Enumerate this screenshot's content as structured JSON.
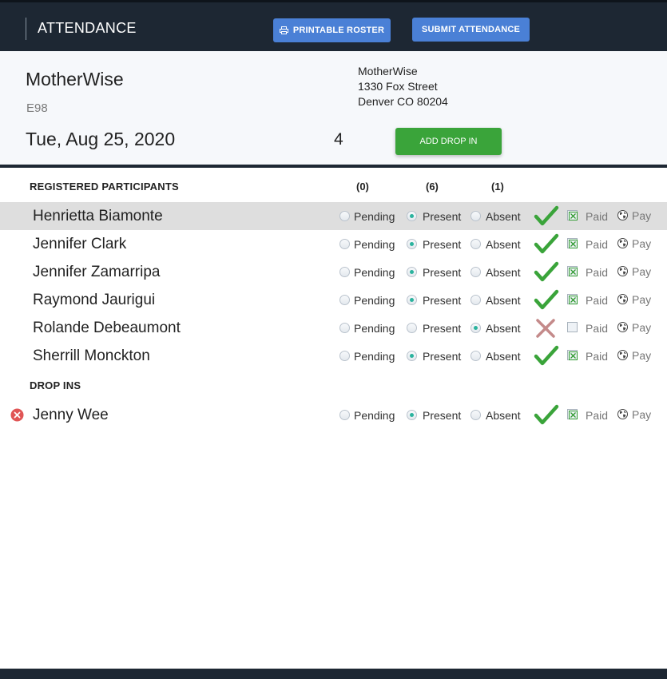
{
  "header": {
    "title": "ATTENDANCE",
    "print_label": "PRINTABLE ROSTER",
    "submit_label": "SUBMIT ATTENDANCE"
  },
  "info": {
    "org": "MotherWise",
    "code": "E98",
    "date": "Tue, Aug 25, 2020",
    "count": "4",
    "address": [
      "MotherWise",
      "1330 Fox Street",
      "Denver CO 80204"
    ],
    "add_drop_in": "ADD DROP IN"
  },
  "registered": {
    "title": "REGISTERED PARTICIPANTS",
    "totals": {
      "pending": "(0)",
      "present": "(6)",
      "absent": "(1)"
    },
    "labels": {
      "pending": "Pending",
      "present": "Present",
      "absent": "Absent",
      "paid": "Paid",
      "pay": "Pay"
    },
    "rows": [
      {
        "name": "Henrietta Biamonte",
        "status": "present",
        "paid": true,
        "highlighted": true
      },
      {
        "name": "Jennifer Clark",
        "status": "present",
        "paid": true,
        "highlighted": false
      },
      {
        "name": "Jennifer Zamarripa",
        "status": "present",
        "paid": true,
        "highlighted": false
      },
      {
        "name": "Raymond Jaurigui",
        "status": "present",
        "paid": true,
        "highlighted": false
      },
      {
        "name": "Rolande Debeaumont",
        "status": "absent",
        "paid": false,
        "highlighted": false
      },
      {
        "name": "Sherrill Monckton",
        "status": "present",
        "paid": true,
        "highlighted": false
      }
    ]
  },
  "drop_ins": {
    "title": "DROP INS",
    "rows": [
      {
        "name": "Jenny Wee",
        "status": "present",
        "paid": true
      }
    ]
  },
  "colors": {
    "header_bg": "#1d2733",
    "blue_button": "#4a80d6",
    "green_button": "#3aa43a",
    "check_green": "#3aa43a",
    "absent_x": "#c48a8a",
    "radio_on": "#2bb39e",
    "remove_red": "#e05555"
  },
  "icons": [
    "printer-icon",
    "checkmark-icon",
    "x-mark-icon",
    "globe-icon",
    "remove-circle-icon",
    "radio-button",
    "checkbox"
  ]
}
